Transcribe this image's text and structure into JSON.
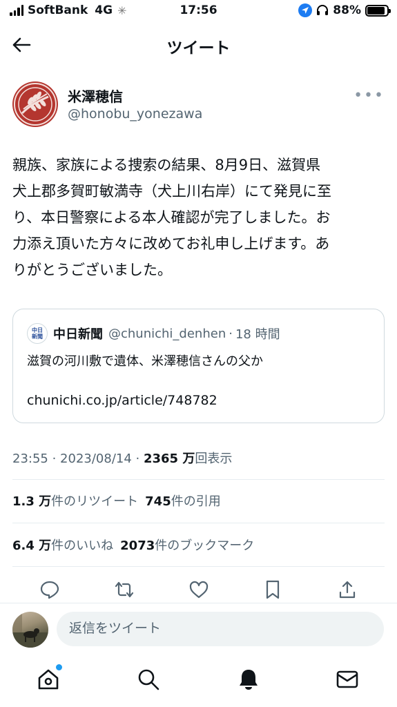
{
  "status_bar": {
    "carrier": "SoftBank",
    "network": "4G",
    "time": "17:56",
    "battery": "88%",
    "battery_level": 0.88
  },
  "nav": {
    "title": "ツイート",
    "back_icon": "arrow-left-icon"
  },
  "tweet": {
    "display_name": "米澤穂信",
    "handle": "@honobu_yonezawa",
    "text": "親族、家族による捜索の結果、8月9日、滋賀県\n犬上郡多賀町敏満寺（犬上川右岸）にて発見に至\nり、本日警察による本人確認が完了しました。お\n力添え頂いた方々に改めてお礼申し上げます。あ\nりがとうございました。",
    "quote": {
      "name": "中日新聞",
      "avatar_text": "中日\n新聞",
      "handle": "@chunichi_denhen",
      "separator": "·",
      "time": "18 時間",
      "text": "滋賀の河川敷で遺体、米澤穂信さんの父か",
      "link": "chunichi.co.jp/article/748782"
    },
    "meta": {
      "time": "23:55 · 2023/08/14 ·",
      "views": "2365 万",
      "views_label": "回表示"
    },
    "stats": {
      "retweets": "1.3 万",
      "retweets_label": "件のリツイート",
      "quotes": "745",
      "quotes_label": "件の引用",
      "likes": "6.4 万",
      "likes_label": "件のいいね",
      "bookmarks": "2073",
      "bookmarks_label": "件のブックマーク"
    }
  },
  "actions": [
    "reply-icon",
    "retweet-icon",
    "like-icon",
    "bookmark-icon",
    "share-icon"
  ],
  "reply": {
    "placeholder": "返信をツイート"
  },
  "tabbar": [
    "home-icon",
    "search-icon",
    "notifications-icon",
    "messages-icon"
  ],
  "colors": {
    "text": "#0f1419",
    "muted": "#536471",
    "accent": "#1d9bf0",
    "avatar": "#b4362f"
  }
}
